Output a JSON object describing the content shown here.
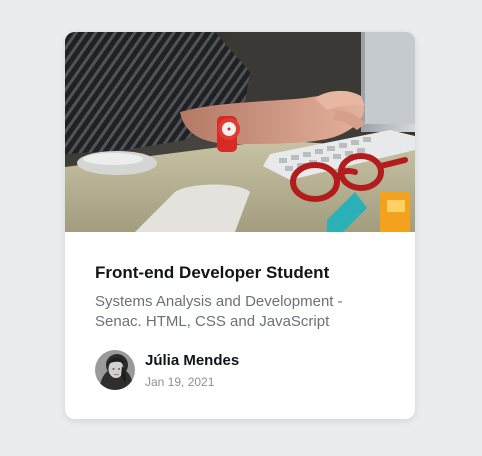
{
  "card": {
    "image_alt": "Person typing on a keyboard with a red watch and glasses",
    "title": "Front-end Developer Student",
    "description": "Systems Analysis and Development - Senac. HTML, CSS and JavaScript",
    "author": {
      "name": "Júlia Mendes",
      "date": "Jan 19, 2021"
    }
  },
  "colors": {
    "page_background": "#e9edef",
    "card_background": "#ffffff",
    "title_text": "#111418",
    "description_text": "#6b7177",
    "date_text": "#8b9096"
  }
}
